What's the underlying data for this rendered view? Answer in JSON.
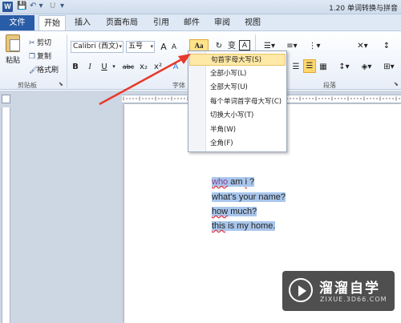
{
  "title_bar": {
    "app_icon_letter": "W",
    "qat_save": "💾",
    "qat_undo": "↶ ▾",
    "qat_redo": "U",
    "qat_more": "▾",
    "window_title": "1.20 单词转换与拼音"
  },
  "tabs": {
    "file": "文件",
    "items": [
      "开始",
      "插入",
      "页面布局",
      "引用",
      "邮件",
      "审阅",
      "视图"
    ]
  },
  "clipboard": {
    "paste": "粘贴",
    "cut": "剪切",
    "copy": "复制",
    "format_painter": "格式刷",
    "group_label": "剪贴板"
  },
  "font": {
    "font_name": "Calibri (西文)",
    "font_size": "五号",
    "grow": "A",
    "shrink": "A",
    "change_case": "Aa",
    "bold": "B",
    "italic": "I",
    "underline": "U",
    "strike": "abc",
    "subscript": "x₂",
    "superscript": "x²",
    "phonetic": "变",
    "border_char": "A",
    "group_label": "字体"
  },
  "paragraph": {
    "group_label": "段落"
  },
  "change_case_menu": {
    "items": [
      {
        "label": "句首字母大写(S)",
        "highlighted": true
      },
      {
        "label": "全部小写(L)",
        "highlighted": false
      },
      {
        "label": "全部大写(U)",
        "highlighted": false
      },
      {
        "label": "每个单词首字母大写(C)",
        "highlighted": false
      },
      {
        "label": "切换大小写(T)",
        "highlighted": false
      },
      {
        "label": "半角(W)",
        "highlighted": false
      },
      {
        "label": "全角(F)",
        "highlighted": false
      }
    ]
  },
  "document": {
    "lines": [
      {
        "words": [
          "who",
          " am ",
          "i",
          " ?"
        ]
      },
      {
        "text": "what's your name?"
      },
      {
        "words": [
          "how",
          " much?"
        ]
      },
      {
        "words": [
          "this",
          " is my home."
        ]
      }
    ]
  },
  "watermark": {
    "title": "溜溜自学",
    "sub": "ZIXUE.3D66.COM"
  },
  "colors": {
    "selection": "#a9c6ec",
    "file_tab": "#2a5da8",
    "arrow": "#e53a2c",
    "menu_highlight": "#ffe9a6"
  }
}
